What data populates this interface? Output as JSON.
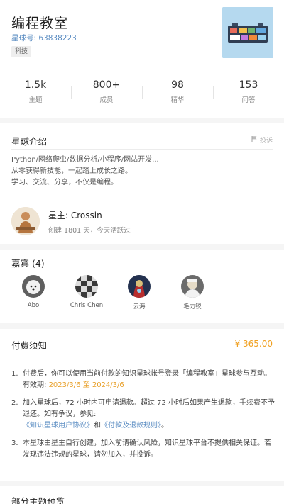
{
  "header": {
    "title": "编程教室",
    "planet_no": "星球号: 63838223",
    "tag": "科技"
  },
  "stats": [
    {
      "value": "1.5k",
      "label": "主题"
    },
    {
      "value": "800+",
      "label": "成员"
    },
    {
      "value": "98",
      "label": "精华"
    },
    {
      "value": "153",
      "label": "问答"
    }
  ],
  "intro": {
    "title": "星球介绍",
    "report": "投诉",
    "lines": [
      "Python/网络爬虫/数据分析/小程序/网站开发...",
      "从零获得新技能，一起踏上成长之路。",
      "学习、交流、分享，不仅是编程。"
    ]
  },
  "owner": {
    "name": "星主: Crossin",
    "meta": "创建 1801 天，今天活跃过"
  },
  "guests": {
    "title": "嘉宾 (4)",
    "items": [
      {
        "name": "Abo"
      },
      {
        "name": "Chris Chen"
      },
      {
        "name": "云海"
      },
      {
        "name": "毛力锐"
      }
    ]
  },
  "fee": {
    "title": "付费须知",
    "price": "¥ 365.00",
    "items": [
      {
        "num": "1.",
        "text": "付费后，你可以使用当前付款的知识星球帐号登录「编程教室」星球参与互动。",
        "validity_label": "有效期: ",
        "validity_value": "2023/3/6 至 2024/3/6"
      },
      {
        "num": "2.",
        "text": "加入星球后，72 小时内可申请退款。超过 72 小时后如果产生退款，手续费不予退还。如有争议，参见:",
        "link1": "《知识星球用户协议》",
        "and": "和",
        "link2": "《付款及退款规则》",
        "end": "。"
      },
      {
        "num": "3.",
        "text": "本星球由星主自行创建，加入前请确认风险，知识星球平台不提供相关保证。若发现违法违规的星球，请勿加入，并投诉。"
      }
    ]
  },
  "preview": {
    "title": "部分主题预览"
  }
}
